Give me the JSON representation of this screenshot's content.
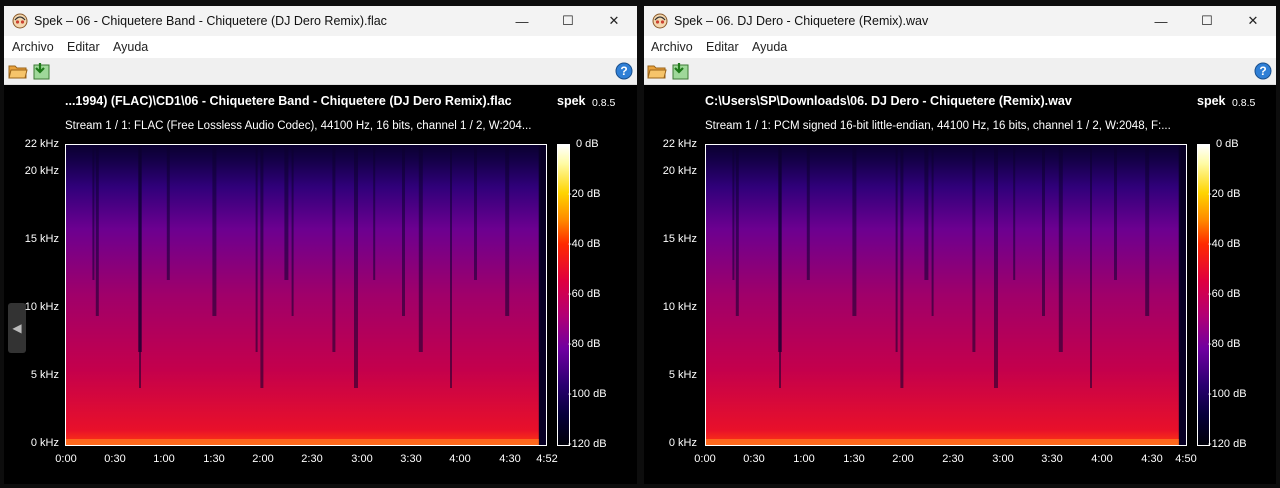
{
  "windows": [
    {
      "title": "Spek – 06 - Chiquetere Band - Chiquetere (DJ Dero Remix).flac",
      "menu": [
        "Archivo",
        "Editar",
        "Ayuda"
      ],
      "file_title": "...1994) (FLAC)\\CD1\\06 - Chiquetere Band - Chiquetere (DJ Dero Remix).flac",
      "app_name": "spek",
      "version": "0.8.5",
      "stream": "Stream 1 / 1: FLAC (Free Lossless Audio Codec), 44100 Hz, 16 bits, channel 1 / 2, W:204...",
      "y_labels": [
        "22 kHz",
        "20 kHz",
        "15 kHz",
        "10 kHz",
        "5 kHz",
        "0 kHz"
      ],
      "x_labels": [
        "0:00",
        "0:30",
        "1:00",
        "1:30",
        "2:00",
        "2:30",
        "3:00",
        "3:30",
        "4:00",
        "4:30",
        "4:52"
      ],
      "colorbar_labels": [
        "0 dB",
        "-20 dB",
        "-40 dB",
        "-60 dB",
        "-80 dB",
        "-100 dB",
        "-120 dB"
      ]
    },
    {
      "title": "Spek – 06. DJ Dero - Chiquetere (Remix).wav",
      "menu": [
        "Archivo",
        "Editar",
        "Ayuda"
      ],
      "file_title": "C:\\Users\\SP\\Downloads\\06. DJ Dero - Chiquetere (Remix).wav",
      "app_name": "spek",
      "version": "0.8.5",
      "stream": "Stream 1 / 1: PCM signed 16-bit little-endian, 44100 Hz, 16 bits, channel 1 / 2, W:2048, F:...",
      "y_labels": [
        "22 kHz",
        "20 kHz",
        "15 kHz",
        "10 kHz",
        "5 kHz",
        "0 kHz"
      ],
      "x_labels": [
        "0:00",
        "0:30",
        "1:00",
        "1:30",
        "2:00",
        "2:30",
        "3:00",
        "3:30",
        "4:00",
        "4:30",
        "4:50"
      ],
      "colorbar_labels": [
        "0 dB",
        "-20 dB",
        "-40 dB",
        "-60 dB",
        "-80 dB",
        "-100 dB",
        "-120 dB"
      ]
    }
  ],
  "icons": {
    "app": "spek-app-icon",
    "open": "folder-open-icon",
    "save": "save-export-icon",
    "help": "help-icon",
    "minimize": "minimize-icon",
    "maximize": "maximize-icon",
    "close": "close-icon"
  }
}
